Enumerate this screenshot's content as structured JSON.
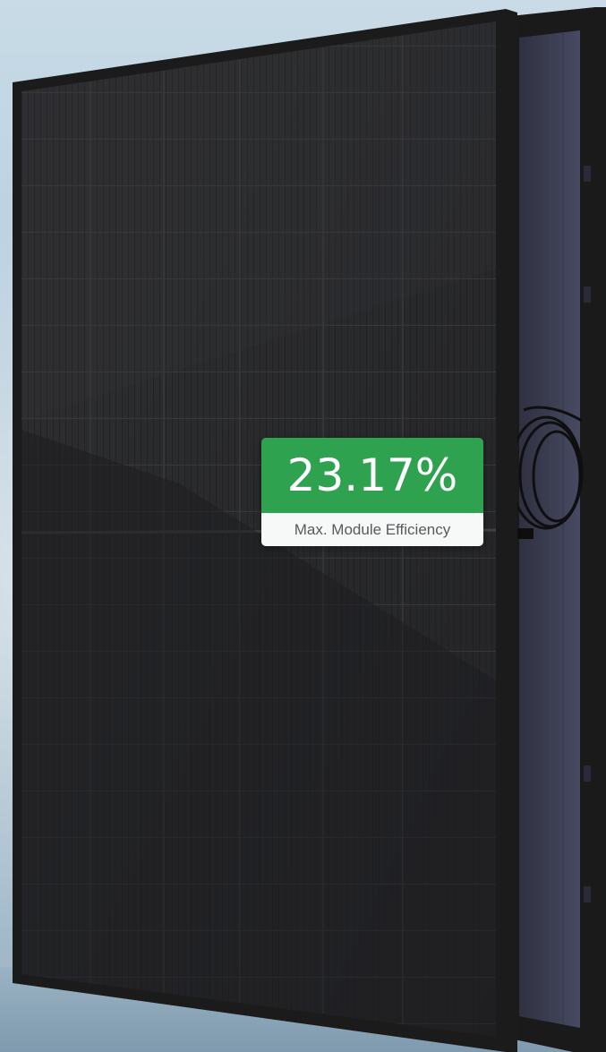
{
  "badge": {
    "value": "23.17%",
    "label": "Max. Module Efficiency",
    "color": "#2ea24f"
  },
  "panel": {
    "frame_color": "#1c1c1d",
    "cell_color": "#2a2a2c",
    "back_panel_color": "#3a3b4e"
  }
}
